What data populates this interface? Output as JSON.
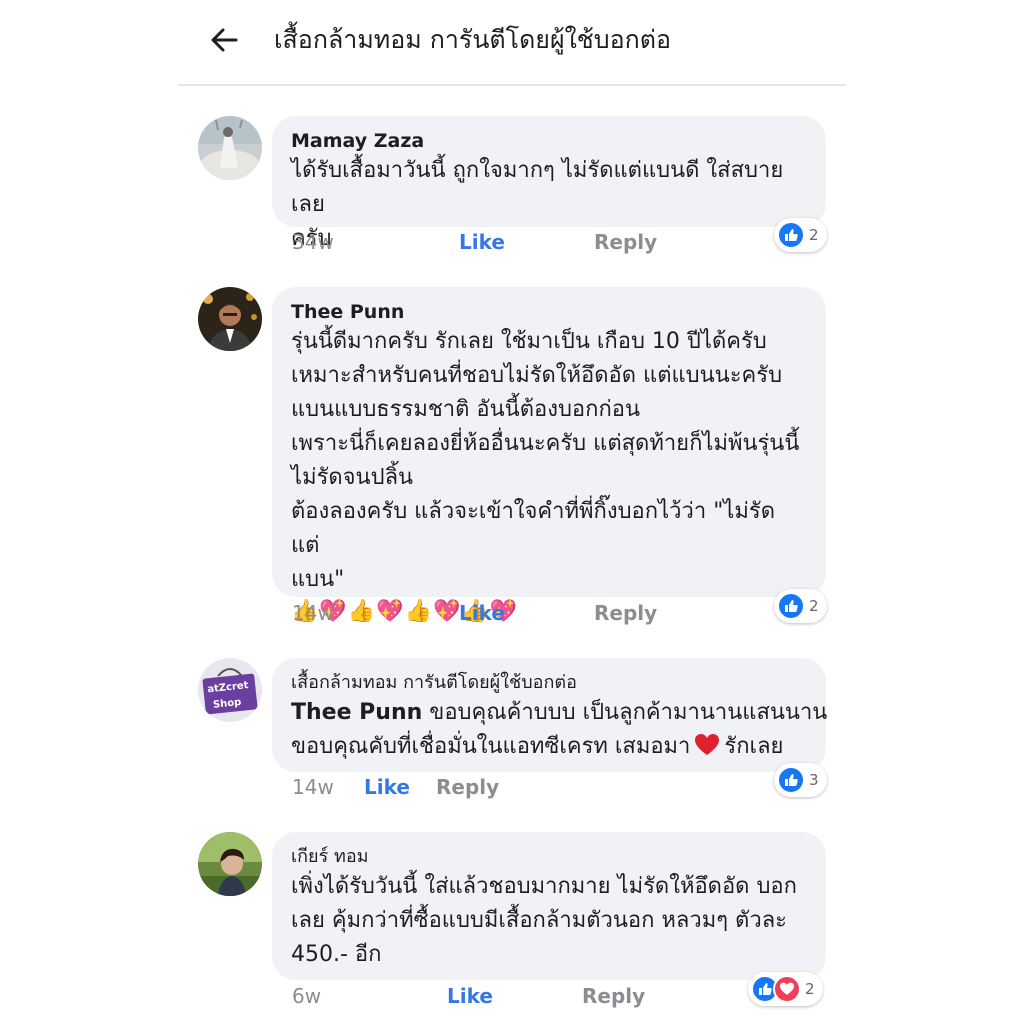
{
  "header": {
    "back_icon": "arrow-left-icon",
    "title": "เสื้อกล้ามทอม การันตีโดยผู้ใช้บอกต่อ"
  },
  "colors": {
    "like_blue": "#3578e5",
    "bubble_bg": "#f0f2f5",
    "love_red": "#f33e58"
  },
  "comments": [
    {
      "author": "Mamay Zaza",
      "text": "ได้รับเสื้อมาวันนี้ ถูกใจมากๆ ไม่รัดแต่แบนดี ใส่สบายเลย\nครับ",
      "time": "34w",
      "like": "Like",
      "reply": "Reply",
      "reaction_count": "2"
    },
    {
      "author": "Thee Punn",
      "text": "รุ่นนี้ดีมากครับ รักเลย ใช้มาเป็น เกือบ 10 ปีได้ครับ\nเหมาะสำหรับคนที่ชอบไม่รัดให้อึดอัด แต่แบนนะครับ\nแบนแบบธรรมชาติ อันนี้ต้องบอกก่อน\nเพราะนี่ก็เคยลองยี่ห้ออื่นนะครับ แต่สุดท้ายก็ไม่พ้นรุ่นนี้\nไม่รัดจนปลิ้น\nต้องลองครับ แล้วจะเข้าใจคำที่พี่กิ๊งบอกไว้ว่า \"ไม่รัด แต่\nแบน\"",
      "emoji": "👍💖👍💖👍💖👍💖",
      "time": "14w",
      "like": "Like",
      "reply": "Reply",
      "reaction_count": "2"
    },
    {
      "author": "เสื้อกล้ามทอม การันตีโดยผู้ใช้บอกต่อ",
      "mention": "Thee Punn",
      "text_line1": " ขอบคุณค้าบบบ เป็นลูกค้ามานานแสนนาน",
      "text_line2": "ขอบคุณคับที่เชื่อมั่นในแอทซีเครท เสมอมา",
      "text_after_heart": "รักเลย",
      "avatar_text_1": "atZcret",
      "avatar_text_2": "Shop",
      "time": "14w",
      "like": "Like",
      "reply": "Reply",
      "reaction_count": "3"
    },
    {
      "author": "เกียร์ ทอม",
      "text": "เพิ่งได้รับวันนี้ ใส่แล้วชอบมากมาย ไม่รัดให้อึดอัด บอก\nเลย คุ้มกว่าที่ซื้อแบบมีเสื้อกล้ามตัวนอก หลวมๆ ตัวละ\n450.- อีก",
      "time": "6w",
      "like": "Like",
      "reply": "Reply",
      "reaction_count": "2"
    }
  ]
}
